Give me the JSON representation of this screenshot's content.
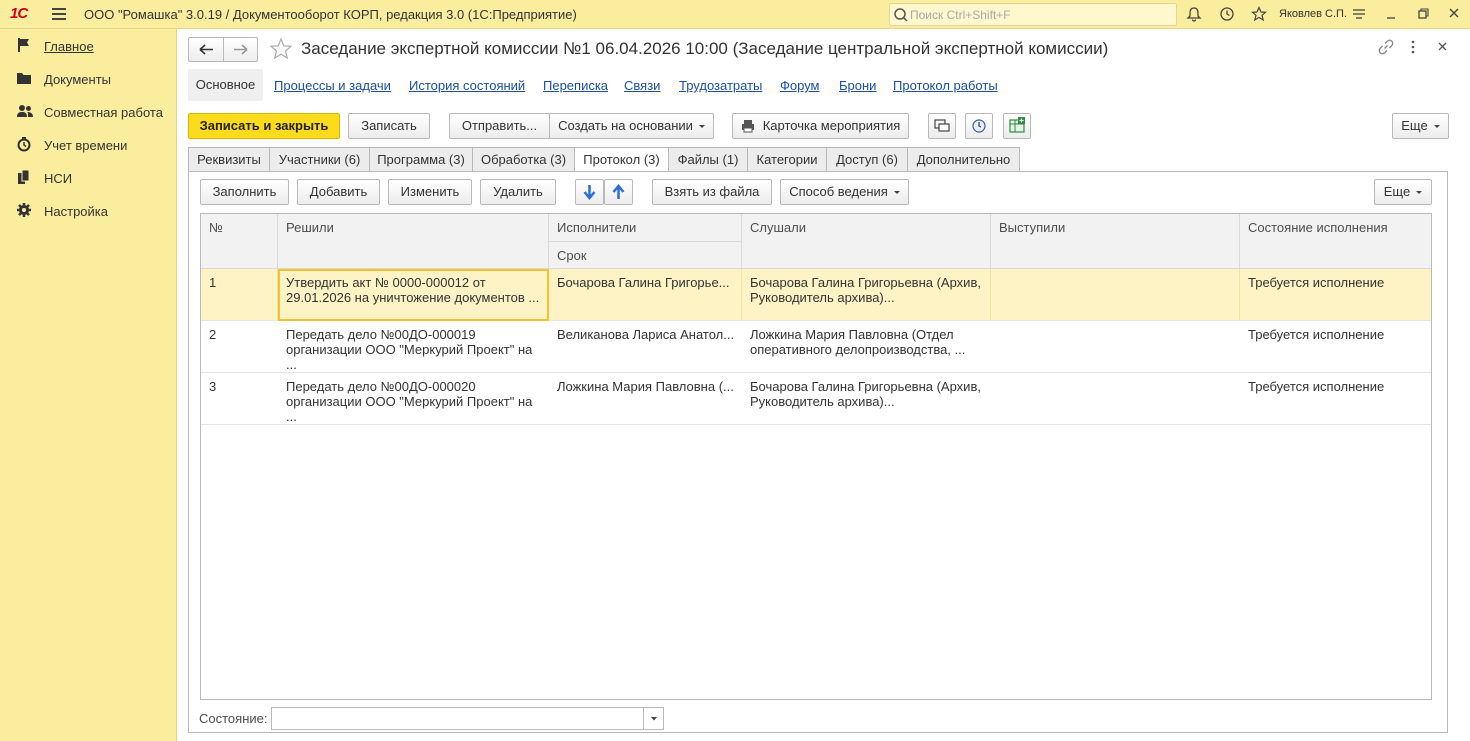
{
  "app": {
    "logo": "1С",
    "title": "ООО \"Ромашка\" 3.0.19 / Документооборот КОРП, редакция 3.0  (1С:Предприятие)",
    "search_placeholder": "Поиск Ctrl+Shift+F",
    "user": "Яковлев С.П."
  },
  "sidebar": {
    "items": [
      {
        "label": "Главное",
        "icon": "flag-icon"
      },
      {
        "label": "Документы",
        "icon": "folder-icon"
      },
      {
        "label": "Совместная работа",
        "icon": "people-icon"
      },
      {
        "label": "Учет времени",
        "icon": "clock-icon"
      },
      {
        "label": "НСИ",
        "icon": "books-icon"
      },
      {
        "label": "Настройка",
        "icon": "gear-icon"
      }
    ]
  },
  "document": {
    "title": "Заседание экспертной комиссии №1 06.04.2026 10:00 (Заседание центральной экспертной комиссии)"
  },
  "nav": {
    "active": "Основное",
    "links": [
      "Процессы и задачи",
      "История состояний",
      "Переписка",
      "Связи",
      "Трудозатраты",
      "Форум",
      "Брони",
      "Протокол работы"
    ]
  },
  "toolbar": {
    "save_close": "Записать и закрыть",
    "save": "Записать",
    "send": "Отправить...",
    "create_based": "Создать на основании",
    "event_card": "Карточка мероприятия",
    "more": "Еще"
  },
  "tabs": [
    "Реквизиты",
    "Участники (6)",
    "Программа (3)",
    "Обработка (3)",
    "Протокол (3)",
    "Файлы (1)",
    "Категории",
    "Доступ (6)",
    "Дополнительно"
  ],
  "grid_toolbar": {
    "fill": "Заполнить",
    "add": "Добавить",
    "edit": "Изменить",
    "delete": "Удалить",
    "from_file": "Взять из файла",
    "method": "Способ ведения",
    "more": "Еще"
  },
  "grid": {
    "columns": {
      "num": "№",
      "decided": "Решили",
      "executors": "Исполнители",
      "deadline": "Срок",
      "heard": "Слушали",
      "spoke": "Выступили",
      "state": "Состояние исполнения"
    },
    "rows": [
      {
        "num": "1",
        "decided": "Утвердить акт № 0000-000012 от 29.01.2026 на уничтожение документов ...",
        "executors": "Бочарова Галина Григорье...",
        "heard": "Бочарова Галина Григорьевна (Архив, Руководитель архива)...",
        "spoke": "",
        "state": "Требуется исполнение"
      },
      {
        "num": "2",
        "decided": "Передать дело №00ДО-000019 организации ООО \"Меркурий Проект\" на ...",
        "executors": "Великанова Лариса Анатол...",
        "heard": "Ложкина Мария Павловна (Отдел оперативного делопроизводства, ...",
        "spoke": "",
        "state": "Требуется исполнение"
      },
      {
        "num": "3",
        "decided": "Передать дело №00ДО-000020 организации ООО \"Меркурий Проект\" на ...",
        "executors": "Ложкина Мария Павловна (...",
        "heard": "Бочарова Галина Григорьевна (Архив, Руководитель архива)...",
        "spoke": "",
        "state": "Требуется исполнение"
      }
    ]
  },
  "footer": {
    "state_label": "Состояние:",
    "state_value": ""
  },
  "colors": {
    "accent_yellow": "#fbdb1c",
    "panel_bg": "#fbed9e",
    "link": "#1c4fa0",
    "selected_row": "#fdf3c4"
  }
}
